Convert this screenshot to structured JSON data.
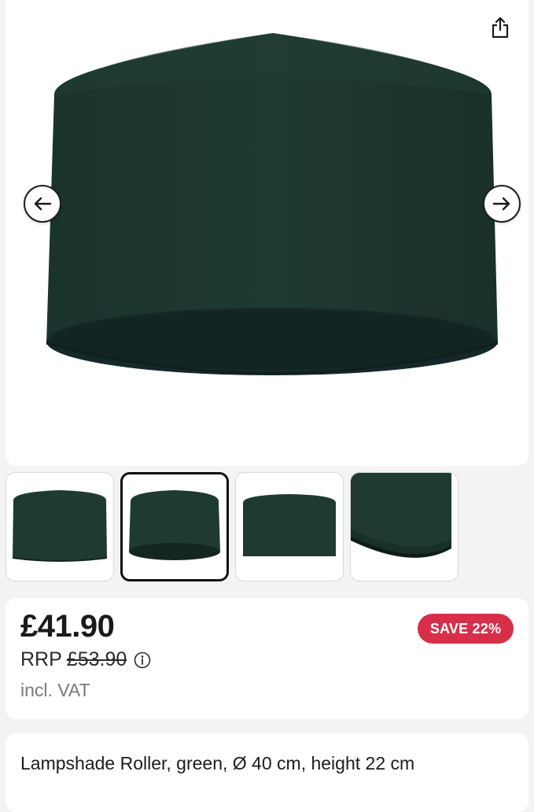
{
  "gallery": {
    "main_image_alt": "",
    "thumbnails": [
      {
        "name": "thumb-1",
        "active": false
      },
      {
        "name": "thumb-2",
        "active": true
      },
      {
        "name": "thumb-3",
        "active": false
      },
      {
        "name": "thumb-4",
        "active": false
      }
    ],
    "share_icon": "share-icon",
    "prev_icon": "arrow-left-icon",
    "next_icon": "arrow-right-icon",
    "product_color": "#1f3a33"
  },
  "pricing": {
    "price": "£41.90",
    "rrp_label": "RRP",
    "rrp_value": "£53.90",
    "vat_note": "incl. VAT",
    "save_badge": "SAVE 22%",
    "badge_color": "#d72f4a"
  },
  "product": {
    "title": "Lampshade Roller, green, Ø 40 cm, height 22 cm"
  }
}
